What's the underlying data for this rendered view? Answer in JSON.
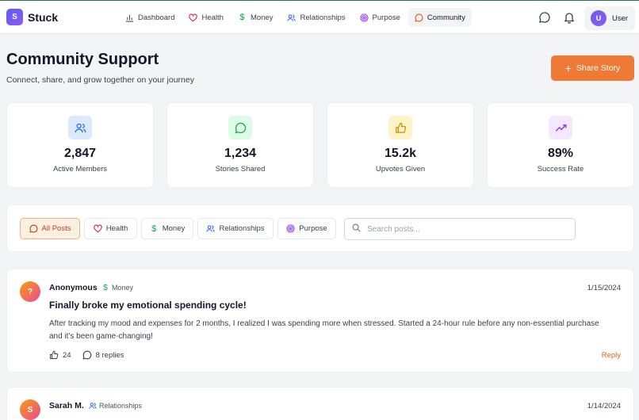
{
  "app": {
    "logo_letter": "S",
    "name": "Stuck"
  },
  "nav": {
    "items": [
      {
        "label": "Dashboard",
        "icon": "bar-chart-icon"
      },
      {
        "label": "Health",
        "icon": "heart-icon"
      },
      {
        "label": "Money",
        "icon": "dollar-icon"
      },
      {
        "label": "Relationships",
        "icon": "users-icon"
      },
      {
        "label": "Purpose",
        "icon": "target-icon"
      },
      {
        "label": "Community",
        "icon": "chat-icon",
        "active": true
      }
    ],
    "user_initial": "U",
    "user_label": "User"
  },
  "header": {
    "title": "Community Support",
    "subtitle": "Connect, share, and grow together on your journey",
    "share_button": "Share Story"
  },
  "stats": [
    {
      "value": "2,847",
      "label": "Active Members",
      "icon": "users-icon",
      "color": "#dbeafe"
    },
    {
      "value": "1,234",
      "label": "Stories Shared",
      "icon": "chat-icon",
      "color": "#dcfce7"
    },
    {
      "value": "15.2k",
      "label": "Upvotes Given",
      "icon": "thumbs-up-icon",
      "color": "#fef3c7"
    },
    {
      "value": "89%",
      "label": "Success Rate",
      "icon": "trending-up-icon",
      "color": "#f3e8ff"
    }
  ],
  "filters": {
    "chips": [
      {
        "label": "All Posts",
        "active": true
      },
      {
        "label": "Health"
      },
      {
        "label": "Money"
      },
      {
        "label": "Relationships"
      },
      {
        "label": "Purpose"
      }
    ],
    "search_placeholder": "Search posts..."
  },
  "posts": [
    {
      "avatar": "?",
      "author": "Anonymous",
      "tag": "Money",
      "date": "1/15/2024",
      "title": "Finally broke my emotional spending cycle!",
      "body": "After tracking my mood and expenses for 2 months, I realized I was spending more when stressed. Started a 24-hour rule before any non-essential purchase and it's been game-changing!",
      "upvotes": "24",
      "replies": "8 replies",
      "reply_label": "Reply"
    },
    {
      "avatar": "S",
      "author": "Sarah M.",
      "tag": "Relationships",
      "date": "1/14/2024"
    }
  ],
  "colors": {
    "accent": "#ed7a35",
    "brand": "#6366f1",
    "active_chip_bg": "#fdf0e3"
  }
}
